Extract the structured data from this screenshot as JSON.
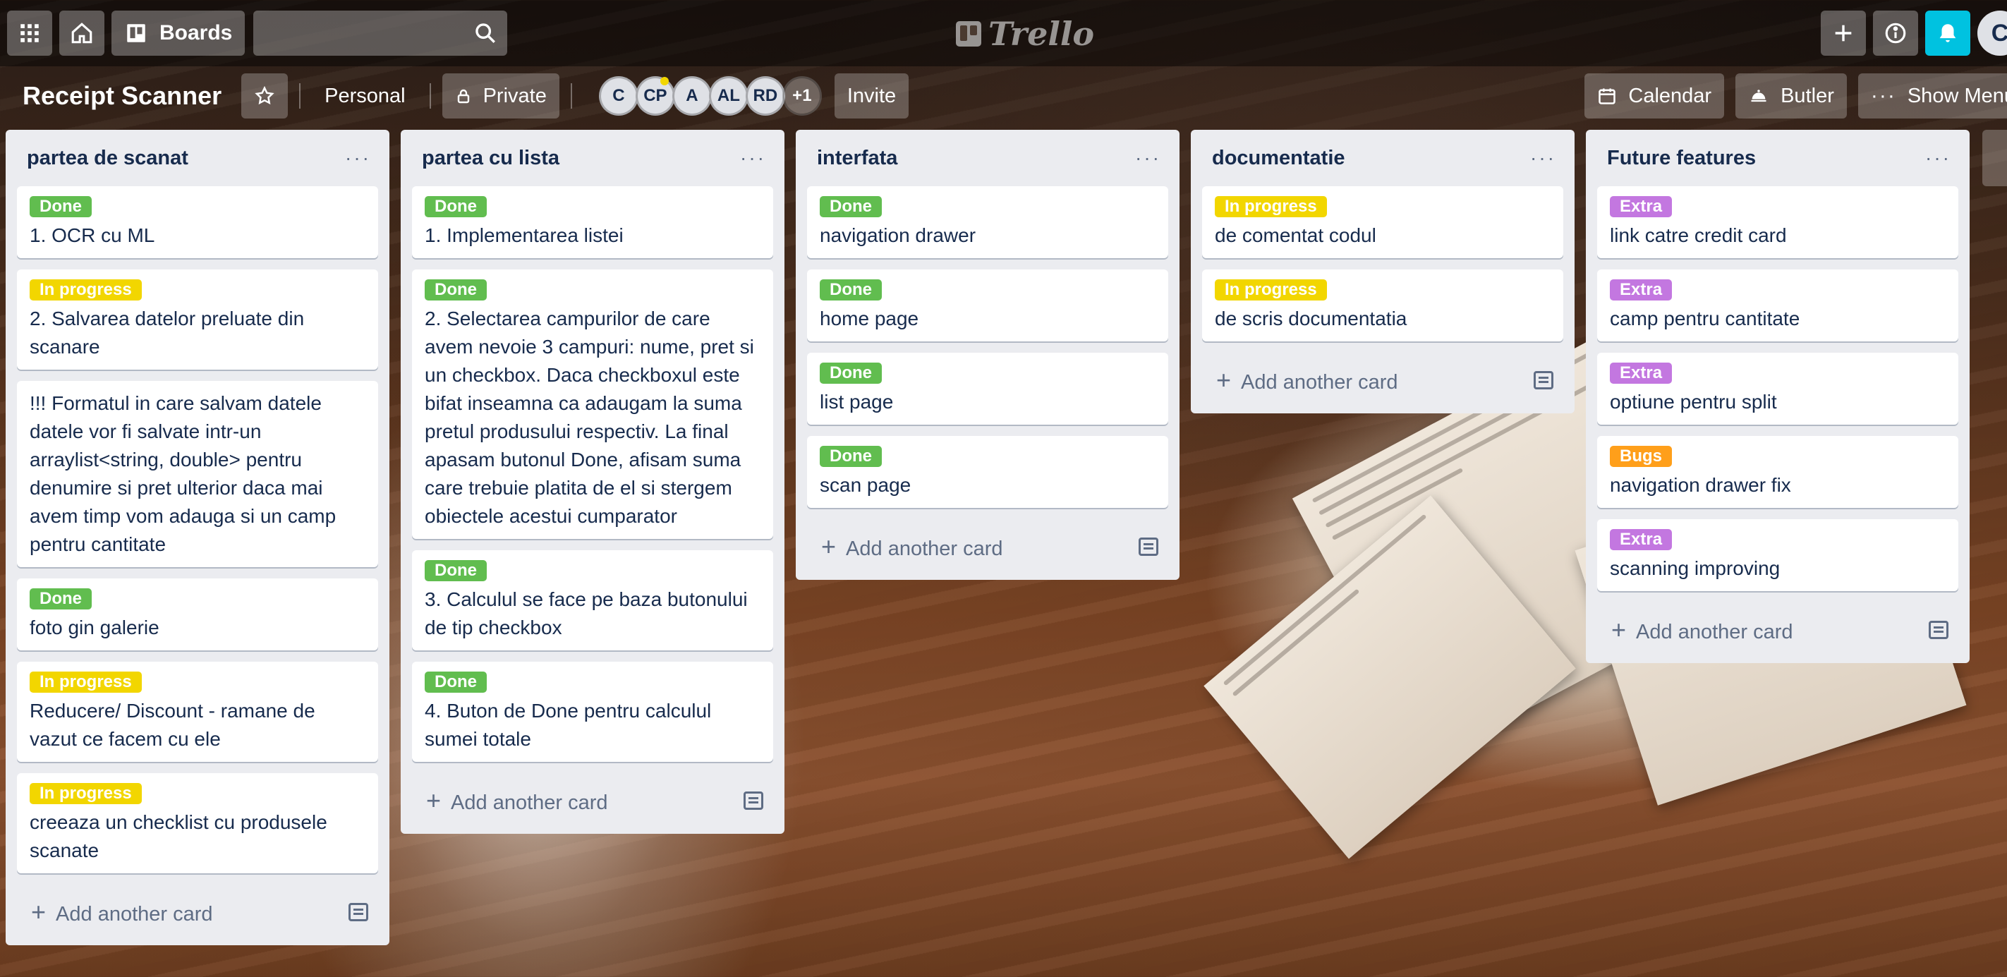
{
  "topbar": {
    "boards_label": "Boards",
    "logo_text": "Trello",
    "user_initial": "C"
  },
  "board": {
    "title": "Receipt Scanner",
    "team_label": "Personal",
    "visibility_label": "Private",
    "members": [
      "C",
      "CP",
      "A",
      "AL",
      "RD"
    ],
    "more_members": "+1",
    "invite_label": "Invite",
    "calendar_label": "Calendar",
    "butler_label": "Butler",
    "show_menu_label": "Show Menu"
  },
  "colors": {
    "Done": "#61bd4f",
    "In progress": "#f2d600",
    "Extra": "#c377e0",
    "Bugs": "#ff9f1a"
  },
  "lists": [
    {
      "title": "partea de scanat",
      "add_label": "Add another card",
      "cards": [
        {
          "label": "Done",
          "text": "1. OCR cu ML"
        },
        {
          "label": "In progress",
          "text": "2. Salvarea datelor preluate din scanare"
        },
        {
          "label": "",
          "text": "!!! Formatul in care salvam datele datele vor fi salvate intr-un arraylist<string, double> pentru denumire si pret ulterior daca mai avem timp vom adauga si un camp pentru cantitate"
        },
        {
          "label": "Done",
          "text": "foto gin galerie"
        },
        {
          "label": "In progress",
          "text": "Reducere/ Discount - ramane de vazut ce facem cu ele"
        },
        {
          "label": "In progress",
          "text": "creeaza un checklist cu produsele scanate"
        }
      ]
    },
    {
      "title": "partea cu lista",
      "add_label": "Add another card",
      "cards": [
        {
          "label": "Done",
          "text": "1. Implementarea listei"
        },
        {
          "label": "Done",
          "text": "2. Selectarea campurilor de care avem nevoie 3 campuri: nume, pret si un checkbox. Daca checkboxul este bifat inseamna ca adaugam la suma pretul produsului respectiv. La final apasam butonul Done, afisam suma care trebuie platita de el si stergem obiectele acestui cumparator"
        },
        {
          "label": "Done",
          "text": "3. Calculul se face pe baza butonului de tip checkbox"
        },
        {
          "label": "Done",
          "text": "4. Buton de Done pentru calculul sumei totale"
        }
      ]
    },
    {
      "title": "interfata",
      "add_label": "Add another card",
      "cards": [
        {
          "label": "Done",
          "text": "navigation drawer"
        },
        {
          "label": "Done",
          "text": "home page"
        },
        {
          "label": "Done",
          "text": "list page"
        },
        {
          "label": "Done",
          "text": "scan page"
        }
      ]
    },
    {
      "title": "documentatie",
      "add_label": "Add another card",
      "cards": [
        {
          "label": "In progress",
          "text": "de comentat codul"
        },
        {
          "label": "In progress",
          "text": "de scris documentatia"
        }
      ]
    },
    {
      "title": "Future features",
      "add_label": "Add another card",
      "cards": [
        {
          "label": "Extra",
          "text": "link catre credit card"
        },
        {
          "label": "Extra",
          "text": "camp pentru cantitate"
        },
        {
          "label": "Extra",
          "text": "optiune pentru split"
        },
        {
          "label": "Bugs",
          "text": "navigation drawer fix"
        },
        {
          "label": "Extra",
          "text": "scanning improving"
        }
      ]
    }
  ]
}
